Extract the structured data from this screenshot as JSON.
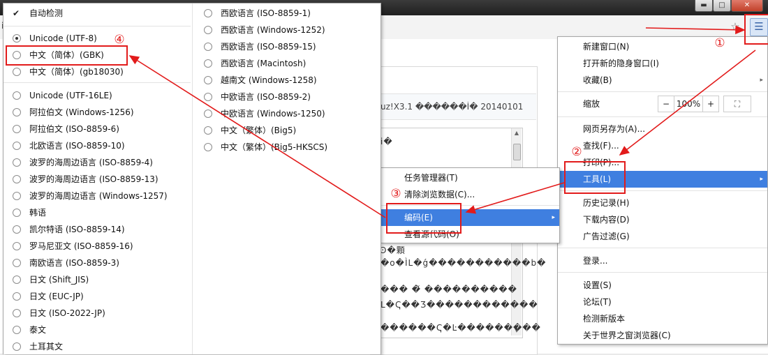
{
  "window": {
    "minimize": "▬",
    "maximize": "□",
    "close": "✕"
  },
  "toolbar": {
    "star_icon": "☆",
    "menu_icon": "☰",
    "cut_text": "i"
  },
  "page": {
    "title": "uz!X3.1 ������Ì� 20140101",
    "garbled": [
      "i�",
      "Ͽ�顆",
      "�o�ÌL�ǵ�����������b�",
      "��� �̌ ����������",
      "L�Ҁ��Ʒ������������",
      "������Ҁ�Ŀ���������"
    ]
  },
  "main_menu": {
    "items": [
      {
        "label": "新建窗口(N)"
      },
      {
        "label": "打开新的隐身窗口(I)"
      },
      {
        "label": "收藏(B)"
      },
      {
        "label": "缩放"
      },
      {
        "label": "网页另存为(A)..."
      },
      {
        "label": "查找(F)..."
      },
      {
        "label": "打印(P)..."
      },
      {
        "label": "工具(L)"
      },
      {
        "label": "历史记录(H)"
      },
      {
        "label": "下载内容(D)"
      },
      {
        "label": "广告过滤(G)"
      },
      {
        "label": "登录..."
      },
      {
        "label": "设置(S)"
      },
      {
        "label": "论坛(T)"
      },
      {
        "label": "检测新版本"
      },
      {
        "label": "关于世界之窗浏览器(C)"
      }
    ],
    "zoom": {
      "minus": "−",
      "value": "100%",
      "plus": "+",
      "fullscreen": "⛶"
    },
    "submenu_arrow": "▸"
  },
  "tools_menu": {
    "items": [
      {
        "label": "任务管理器(T)"
      },
      {
        "label": "清除浏览数据(C)..."
      },
      {
        "label": "编码(E)"
      },
      {
        "label": "查看源代码(O)"
      }
    ]
  },
  "encoding_menu": {
    "auto_detect": "自动检测",
    "check_mark": "✔",
    "left": [
      {
        "label": "Unicode (UTF-8)",
        "selected": true
      },
      {
        "label": "中文（简体）(GBK)",
        "selected": false
      },
      {
        "label": "中文（简体）(gb18030)",
        "selected": false
      },
      {
        "label": "Unicode (UTF-16LE)",
        "selected": false
      },
      {
        "label": "阿拉伯文 (Windows-1256)",
        "selected": false
      },
      {
        "label": "阿拉伯文 (ISO-8859-6)",
        "selected": false
      },
      {
        "label": "北欧语言 (ISO-8859-10)",
        "selected": false
      },
      {
        "label": "波罗的海周边语言 (ISO-8859-4)",
        "selected": false
      },
      {
        "label": "波罗的海周边语言 (ISO-8859-13)",
        "selected": false
      },
      {
        "label": "波罗的海周边语言 (Windows-1257)",
        "selected": false
      },
      {
        "label": "韩语",
        "selected": false
      },
      {
        "label": "凯尔特语 (ISO-8859-14)",
        "selected": false
      },
      {
        "label": "罗马尼亚文 (ISO-8859-16)",
        "selected": false
      },
      {
        "label": "南欧语言 (ISO-8859-3)",
        "selected": false
      },
      {
        "label": "日文 (Shift_JIS)",
        "selected": false
      },
      {
        "label": "日文 (EUC-JP)",
        "selected": false
      },
      {
        "label": "日文 (ISO-2022-JP)",
        "selected": false
      },
      {
        "label": "泰文",
        "selected": false
      },
      {
        "label": "土耳其文",
        "selected": false
      }
    ],
    "right": [
      {
        "label": "西欧语言 (ISO-8859-1)"
      },
      {
        "label": "西欧语言 (Windows-1252)"
      },
      {
        "label": "西欧语言 (ISO-8859-15)"
      },
      {
        "label": "西欧语言 (Macintosh)"
      },
      {
        "label": "越南文 (Windows-1258)"
      },
      {
        "label": "中欧语言 (ISO-8859-2)"
      },
      {
        "label": "中欧语言 (Windows-1250)"
      },
      {
        "label": "中文（繁体）(Big5)"
      },
      {
        "label": "中文（繁体）(Big5-HKSCS)"
      }
    ]
  },
  "annotations": {
    "step1": "①",
    "step2": "②",
    "step3": "③",
    "step4": "④",
    "color": "#e21b1b"
  }
}
